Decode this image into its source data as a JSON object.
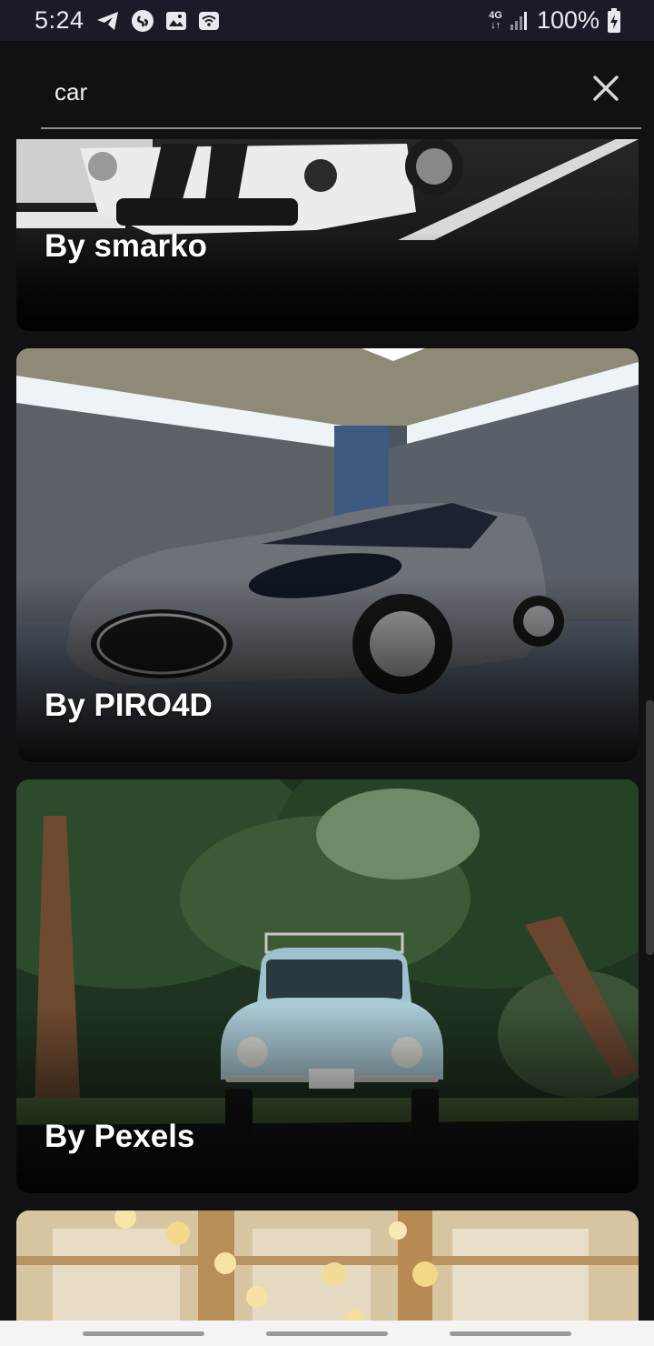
{
  "status_bar": {
    "time": "5:24",
    "left_icons": [
      "telegram-icon",
      "shazam-icon",
      "gallery-icon",
      "wifi-call-icon"
    ],
    "network": "4G",
    "battery_percent": "100%",
    "battery_charging": true
  },
  "search": {
    "query": "car",
    "clear_icon": "close-icon"
  },
  "results": [
    {
      "caption": "By smarko",
      "subject": "white sports car with black stripes"
    },
    {
      "caption": "By PIRO4D",
      "subject": "silver coupe in stone garage"
    },
    {
      "caption": "By Pexels",
      "subject": "light blue beetle on tree-lined road"
    },
    {
      "caption": "",
      "subject": "blurred bokeh lights"
    }
  ],
  "colors": {
    "background": "#111113",
    "status_bar": "#1c1a28",
    "search_underline": "#8c8c90",
    "nav_bar": "#f4f4f4"
  }
}
